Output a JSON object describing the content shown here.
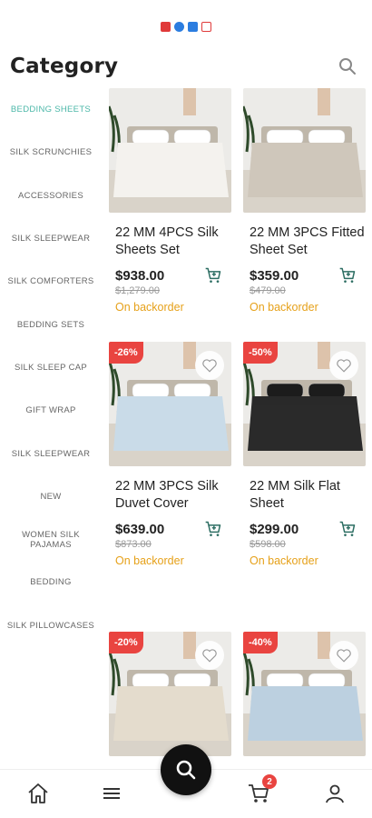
{
  "header": {
    "title": "Category"
  },
  "colors": {
    "accent": "#4bb7a8",
    "sale_badge": "#e94440",
    "backorder": "#e6a11a"
  },
  "sidebar": {
    "items": [
      {
        "label": "BEDDING SHEETS",
        "active": true
      },
      {
        "label": "SILK SCRUNCHIES"
      },
      {
        "label": "ACCESSORIES"
      },
      {
        "label": "SILK SLEEPWEAR"
      },
      {
        "label": "SILK COMFORTERS"
      },
      {
        "label": "BEDDING SETS"
      },
      {
        "label": "SILK SLEEP CAP"
      },
      {
        "label": "GIFT WRAP"
      },
      {
        "label": "SILK SLEEPWEAR"
      },
      {
        "label": "NEW"
      },
      {
        "label": "WOMEN SILK PAJAMAS"
      },
      {
        "label": "BEDDING"
      },
      {
        "label": "SILK PILLOWCASES"
      }
    ]
  },
  "products": [
    {
      "name": "22 MM 4PCS Silk Sheets Set",
      "price": "$938.00",
      "old_price": "$1,279.00",
      "stock": "On backorder",
      "badge": "",
      "sheet_color": "#f4f2ee"
    },
    {
      "name": "22 MM 3PCS Fitted Sheet Set",
      "price": "$359.00",
      "old_price": "$479.00",
      "stock": "On backorder",
      "badge": "",
      "sheet_color": "#cfc7bb"
    },
    {
      "name": "22 MM 3PCS Silk Duvet Cover",
      "price": "$639.00",
      "old_price": "$873.00",
      "stock": "On backorder",
      "badge": "-26%",
      "sheet_color": "#c9dbe8"
    },
    {
      "name": "22 MM Silk Flat Sheet",
      "price": "$299.00",
      "old_price": "$598.00",
      "stock": "On backorder",
      "badge": "-50%",
      "sheet_color": "#2a2a2a"
    },
    {
      "name": "",
      "price": "",
      "old_price": "",
      "stock": "",
      "badge": "-20%",
      "sheet_color": "#e4dccd"
    },
    {
      "name": "",
      "price": "",
      "old_price": "",
      "stock": "",
      "badge": "-40%",
      "sheet_color": "#bcd0e0"
    }
  ],
  "bottom_nav": {
    "items": [
      "home-icon",
      "menu-icon",
      "search-icon",
      "cart-icon",
      "user-icon"
    ],
    "cart_count": "2"
  }
}
